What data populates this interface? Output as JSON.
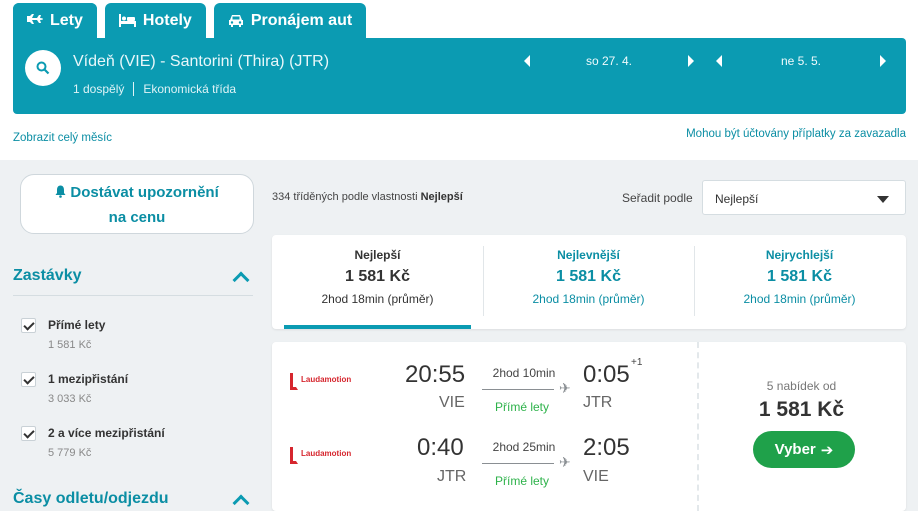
{
  "tabs": [
    {
      "label": "Lety",
      "icon": "plane-icon",
      "active": true
    },
    {
      "label": "Hotely",
      "icon": "bed-icon"
    },
    {
      "label": "Pronájem aut",
      "icon": "car-icon"
    }
  ],
  "search": {
    "route": "Vídeň (VIE) - Santorini (Thira) (JTR)",
    "passengers": "1 dospělý",
    "cabin": "Ekonomická třída",
    "depart_date": "so 27. 4.",
    "return_date": "ne 5. 5."
  },
  "links": {
    "whole_month": "Zobrazit celý měsíc",
    "fees": "Mohou být účtovány příplatky za zavazadla"
  },
  "notify": {
    "line1": "Dostávat upozornění",
    "line2": "na cenu"
  },
  "filters": {
    "stops_title": "Zastávky",
    "stops": [
      {
        "label": "Přímé lety",
        "price": "1 581 Kč",
        "checked": true
      },
      {
        "label": "1 mezipřistání",
        "price": "3 033 Kč",
        "checked": true
      },
      {
        "label": "2 a více mezipřistání",
        "price": "5 779 Kč",
        "checked": true
      }
    ],
    "times_title": "Časy odletu/odjezdu"
  },
  "results": {
    "count_prefix": "334 tříděných podle vlastnosti ",
    "count_sort": "Nejlepší",
    "sort_label": "Seřadit podle",
    "sort_value": "Nejlepší"
  },
  "sort_tabs": [
    {
      "name": "Nejlepší",
      "price": "1 581 Kč",
      "duration": "2hod 18min (průměr)",
      "active": true
    },
    {
      "name": "Nejlevnější",
      "price": "1 581 Kč",
      "duration": "2hod 18min (průměr)"
    },
    {
      "name": "Nejrychlejší",
      "price": "1 581 Kč",
      "duration": "2hod 18min (průměr)"
    }
  ],
  "flight": {
    "outbound": {
      "airline": "Laudamotion",
      "dep_time": "20:55",
      "dep_code": "VIE",
      "duration": "2hod 10min",
      "stops": "Přímé lety",
      "arr_time": "0:05",
      "day_offset": "+1",
      "arr_code": "JTR"
    },
    "inbound": {
      "airline": "Laudamotion",
      "dep_time": "0:40",
      "dep_code": "JTR",
      "duration": "2hod 25min",
      "stops": "Přímé lety",
      "arr_time": "2:05",
      "arr_code": "VIE"
    },
    "offers": "5 nabídek od",
    "price": "1 581 Kč",
    "choose_label": "Vyber"
  },
  "colors": {
    "brand": "#0b9bb2",
    "link": "#0b8ea4",
    "cta": "#1fa14a",
    "direct": "#2db24a",
    "airline_red": "#d6262e"
  }
}
